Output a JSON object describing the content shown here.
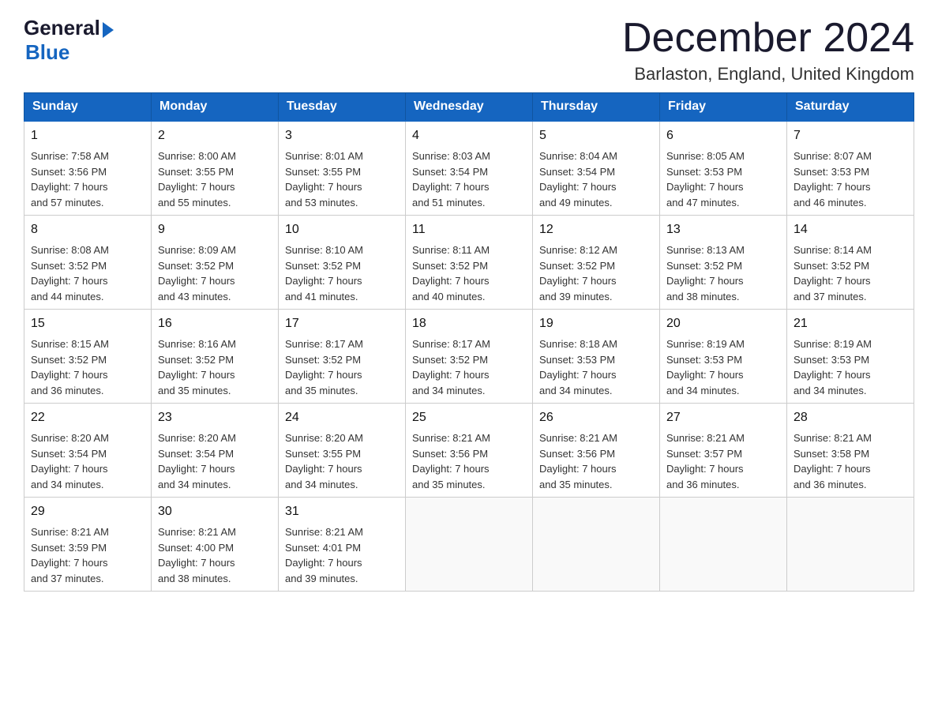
{
  "header": {
    "logo_general": "General",
    "logo_blue": "Blue",
    "month_title": "December 2024",
    "location": "Barlaston, England, United Kingdom"
  },
  "weekdays": [
    "Sunday",
    "Monday",
    "Tuesday",
    "Wednesday",
    "Thursday",
    "Friday",
    "Saturday"
  ],
  "weeks": [
    [
      {
        "day": "1",
        "sunrise": "7:58 AM",
        "sunset": "3:56 PM",
        "daylight": "7 hours and 57 minutes."
      },
      {
        "day": "2",
        "sunrise": "8:00 AM",
        "sunset": "3:55 PM",
        "daylight": "7 hours and 55 minutes."
      },
      {
        "day": "3",
        "sunrise": "8:01 AM",
        "sunset": "3:55 PM",
        "daylight": "7 hours and 53 minutes."
      },
      {
        "day": "4",
        "sunrise": "8:03 AM",
        "sunset": "3:54 PM",
        "daylight": "7 hours and 51 minutes."
      },
      {
        "day": "5",
        "sunrise": "8:04 AM",
        "sunset": "3:54 PM",
        "daylight": "7 hours and 49 minutes."
      },
      {
        "day": "6",
        "sunrise": "8:05 AM",
        "sunset": "3:53 PM",
        "daylight": "7 hours and 47 minutes."
      },
      {
        "day": "7",
        "sunrise": "8:07 AM",
        "sunset": "3:53 PM",
        "daylight": "7 hours and 46 minutes."
      }
    ],
    [
      {
        "day": "8",
        "sunrise": "8:08 AM",
        "sunset": "3:52 PM",
        "daylight": "7 hours and 44 minutes."
      },
      {
        "day": "9",
        "sunrise": "8:09 AM",
        "sunset": "3:52 PM",
        "daylight": "7 hours and 43 minutes."
      },
      {
        "day": "10",
        "sunrise": "8:10 AM",
        "sunset": "3:52 PM",
        "daylight": "7 hours and 41 minutes."
      },
      {
        "day": "11",
        "sunrise": "8:11 AM",
        "sunset": "3:52 PM",
        "daylight": "7 hours and 40 minutes."
      },
      {
        "day": "12",
        "sunrise": "8:12 AM",
        "sunset": "3:52 PM",
        "daylight": "7 hours and 39 minutes."
      },
      {
        "day": "13",
        "sunrise": "8:13 AM",
        "sunset": "3:52 PM",
        "daylight": "7 hours and 38 minutes."
      },
      {
        "day": "14",
        "sunrise": "8:14 AM",
        "sunset": "3:52 PM",
        "daylight": "7 hours and 37 minutes."
      }
    ],
    [
      {
        "day": "15",
        "sunrise": "8:15 AM",
        "sunset": "3:52 PM",
        "daylight": "7 hours and 36 minutes."
      },
      {
        "day": "16",
        "sunrise": "8:16 AM",
        "sunset": "3:52 PM",
        "daylight": "7 hours and 35 minutes."
      },
      {
        "day": "17",
        "sunrise": "8:17 AM",
        "sunset": "3:52 PM",
        "daylight": "7 hours and 35 minutes."
      },
      {
        "day": "18",
        "sunrise": "8:17 AM",
        "sunset": "3:52 PM",
        "daylight": "7 hours and 34 minutes."
      },
      {
        "day": "19",
        "sunrise": "8:18 AM",
        "sunset": "3:53 PM",
        "daylight": "7 hours and 34 minutes."
      },
      {
        "day": "20",
        "sunrise": "8:19 AM",
        "sunset": "3:53 PM",
        "daylight": "7 hours and 34 minutes."
      },
      {
        "day": "21",
        "sunrise": "8:19 AM",
        "sunset": "3:53 PM",
        "daylight": "7 hours and 34 minutes."
      }
    ],
    [
      {
        "day": "22",
        "sunrise": "8:20 AM",
        "sunset": "3:54 PM",
        "daylight": "7 hours and 34 minutes."
      },
      {
        "day": "23",
        "sunrise": "8:20 AM",
        "sunset": "3:54 PM",
        "daylight": "7 hours and 34 minutes."
      },
      {
        "day": "24",
        "sunrise": "8:20 AM",
        "sunset": "3:55 PM",
        "daylight": "7 hours and 34 minutes."
      },
      {
        "day": "25",
        "sunrise": "8:21 AM",
        "sunset": "3:56 PM",
        "daylight": "7 hours and 35 minutes."
      },
      {
        "day": "26",
        "sunrise": "8:21 AM",
        "sunset": "3:56 PM",
        "daylight": "7 hours and 35 minutes."
      },
      {
        "day": "27",
        "sunrise": "8:21 AM",
        "sunset": "3:57 PM",
        "daylight": "7 hours and 36 minutes."
      },
      {
        "day": "28",
        "sunrise": "8:21 AM",
        "sunset": "3:58 PM",
        "daylight": "7 hours and 36 minutes."
      }
    ],
    [
      {
        "day": "29",
        "sunrise": "8:21 AM",
        "sunset": "3:59 PM",
        "daylight": "7 hours and 37 minutes."
      },
      {
        "day": "30",
        "sunrise": "8:21 AM",
        "sunset": "4:00 PM",
        "daylight": "7 hours and 38 minutes."
      },
      {
        "day": "31",
        "sunrise": "8:21 AM",
        "sunset": "4:01 PM",
        "daylight": "7 hours and 39 minutes."
      },
      null,
      null,
      null,
      null
    ]
  ],
  "labels": {
    "sunrise": "Sunrise:",
    "sunset": "Sunset:",
    "daylight": "Daylight:"
  }
}
